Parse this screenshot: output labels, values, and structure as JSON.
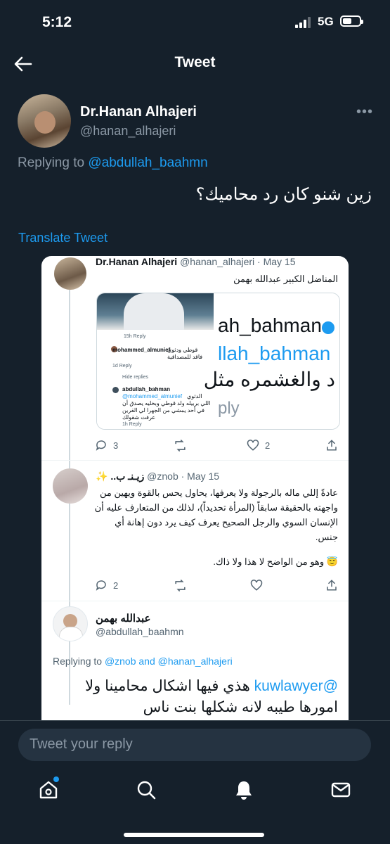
{
  "status_bar": {
    "time": "5:12",
    "network": "5G"
  },
  "header": {
    "title": "Tweet"
  },
  "tweet": {
    "author_name": "Dr.Hanan Alhajeri",
    "author_handle": "@hanan_alhajeri",
    "replying_prefix": "Replying to ",
    "replying_to": "@abdullah_baahmn",
    "text": "زين شنو كان رد محاميك؟",
    "translate_label": "Translate Tweet"
  },
  "embedded": {
    "tweet1": {
      "name": "Dr.Hanan Alhajeri",
      "handle_date": "@hanan_alhajeri · May 15",
      "text": "المناضل الكبير عبدالله بهمن",
      "replies": "3",
      "likes": "2",
      "media": {
        "big_line1": "ah_bahman",
        "big_line2": "llah_bahman",
        "big_line3": "د والغشمره مثل",
        "big_line4": "ply",
        "time1": "15h   Reply",
        "c1_user": "mohammed_almunief",
        "c1_text1": "قوطي ودثوي",
        "c1_text2": "فاقد للمصداقية",
        "c1_meta": "1d   Reply",
        "hide_replies": "Hide replies",
        "c2_user": "abdullah_bahman",
        "c2_text1": "الدثوي",
        "c2_mention": "@mohammed_almunief",
        "c2_text2": "اللي بربيله ولد قوطي وبخليه يصدق أن",
        "c2_text3": "في أحد يمشي من الجهرا لي القرين",
        "c2_text4": "عرفت شقولك",
        "c2_meta": "1h   Reply"
      }
    },
    "tweet2": {
      "name": "..زيـنـ ب",
      "handle_date": "@znob · May 15",
      "text_line1": "عادةً إللي ماله بالرجولة ولا يعرفها، يحاول يحس بالقوة ويهين من",
      "text_line2": "واجهته بالحقيقة سابقاً (المرأة تحديداً)، لذلك من المتعارف عليه أن",
      "text_line3": "الإنسان السوي والرجل الصحيح يعرف كيف يرد دون إهانة أي",
      "text_line4": "جنس.",
      "text_line5": "وهو من الواضح لا هذا ولا ذاك.",
      "replies": "2"
    },
    "tweet3": {
      "name": "عبدالله بهمن",
      "handle": "@abdullah_baahmn",
      "replying_prefix": "Replying to ",
      "replying_to": "@znob and @hanan_alhajeri",
      "mention": "@kuwlawyer",
      "text_line1": "هذي فيها اشكال محامينا ولا",
      "text_line2": "امورها طيبه لانه شكلها بنت ناس"
    }
  },
  "composer": {
    "placeholder": "Tweet your reply"
  },
  "nav": {
    "items": [
      "home-icon",
      "search-icon",
      "notifications-icon",
      "messages-icon"
    ]
  }
}
